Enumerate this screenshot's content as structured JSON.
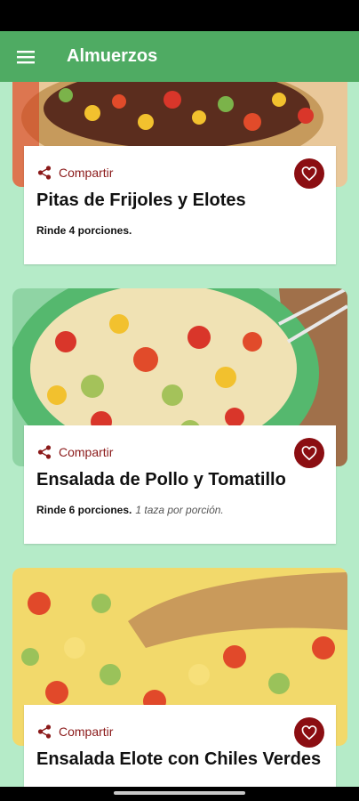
{
  "app_bar": {
    "title": "Almuerzos",
    "menu_icon": "hamburger-menu-icon",
    "color": "#4fab63"
  },
  "colors": {
    "background": "#b5ebc8",
    "favorite": "#8b0e12",
    "share_text": "#8b1a1a"
  },
  "recipes": [
    {
      "title": "Pitas de Frijoles y Elotes",
      "share_label": "Compartir",
      "yield": "Rinde 4 porciones.",
      "serving_note": "",
      "favorite_icon": "heart-outline-icon"
    },
    {
      "title": "Ensalada de Pollo y Tomatillo",
      "share_label": "Compartir",
      "yield": "Rinde 6 porciones.",
      "serving_note": "1 taza por porción.",
      "favorite_icon": "heart-outline-icon"
    },
    {
      "title": "Ensalada Elote con Chiles Verdes",
      "share_label": "Compartir",
      "yield": "",
      "serving_note": "",
      "favorite_icon": "heart-outline-icon"
    }
  ]
}
